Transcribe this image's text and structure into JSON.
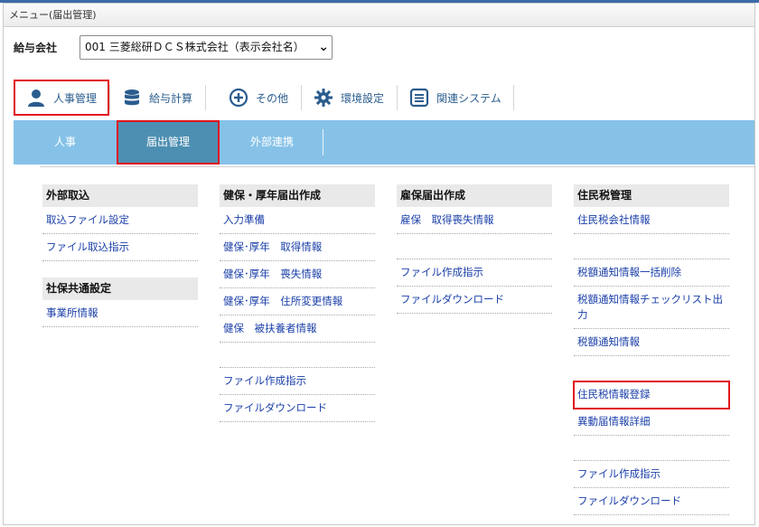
{
  "titlebar": {
    "text": "メニュー(届出管理)"
  },
  "company": {
    "label": "給与会社",
    "selected": "001 三菱総研ＤＣＳ株式会社（表示会社名）"
  },
  "main_nav": [
    {
      "label": "人事管理",
      "icon": "person-icon"
    },
    {
      "label": "給与計算",
      "icon": "database-icon"
    },
    {
      "label": "その他",
      "icon": "plus-circle-icon"
    },
    {
      "label": "環境設定",
      "icon": "gear-icon"
    },
    {
      "label": "関連システム",
      "icon": "list-window-icon"
    }
  ],
  "sub_nav": [
    {
      "label": "人事"
    },
    {
      "label": "届出管理"
    },
    {
      "label": "外部連携"
    }
  ],
  "columns": [
    {
      "sections": [
        {
          "title": "外部取込",
          "items": [
            "取込ファイル設定",
            "ファイル取込指示"
          ]
        },
        {
          "title": "社保共通設定",
          "items": [
            "事業所情報"
          ]
        }
      ]
    },
    {
      "sections": [
        {
          "title": "健保・厚年届出作成",
          "items": [
            "入力準備",
            "健保･厚年　取得情報",
            "健保･厚年　喪失情報",
            "健保･厚年　住所変更情報",
            "健保　被扶養者情報",
            "",
            "ファイル作成指示",
            "ファイルダウンロード"
          ]
        }
      ]
    },
    {
      "sections": [
        {
          "title": "雇保届出作成",
          "items": [
            "雇保　取得喪失情報",
            "",
            "ファイル作成指示",
            "ファイルダウンロード"
          ]
        }
      ]
    },
    {
      "sections": [
        {
          "title": "住民税管理",
          "items": [
            "住民税会社情報",
            "",
            "税額通知情報一括削除",
            "税額通知情報チェックリスト出力",
            "税額通知情報",
            "",
            "住民税情報登録",
            "異動届情報詳細",
            "",
            "ファイル作成指示",
            "ファイルダウンロード"
          ]
        }
      ]
    }
  ],
  "colors": {
    "accent": "#86c2e8",
    "active_tab": "#4d8fb2",
    "highlight": "#e0141e",
    "link": "#1a3fa8"
  }
}
